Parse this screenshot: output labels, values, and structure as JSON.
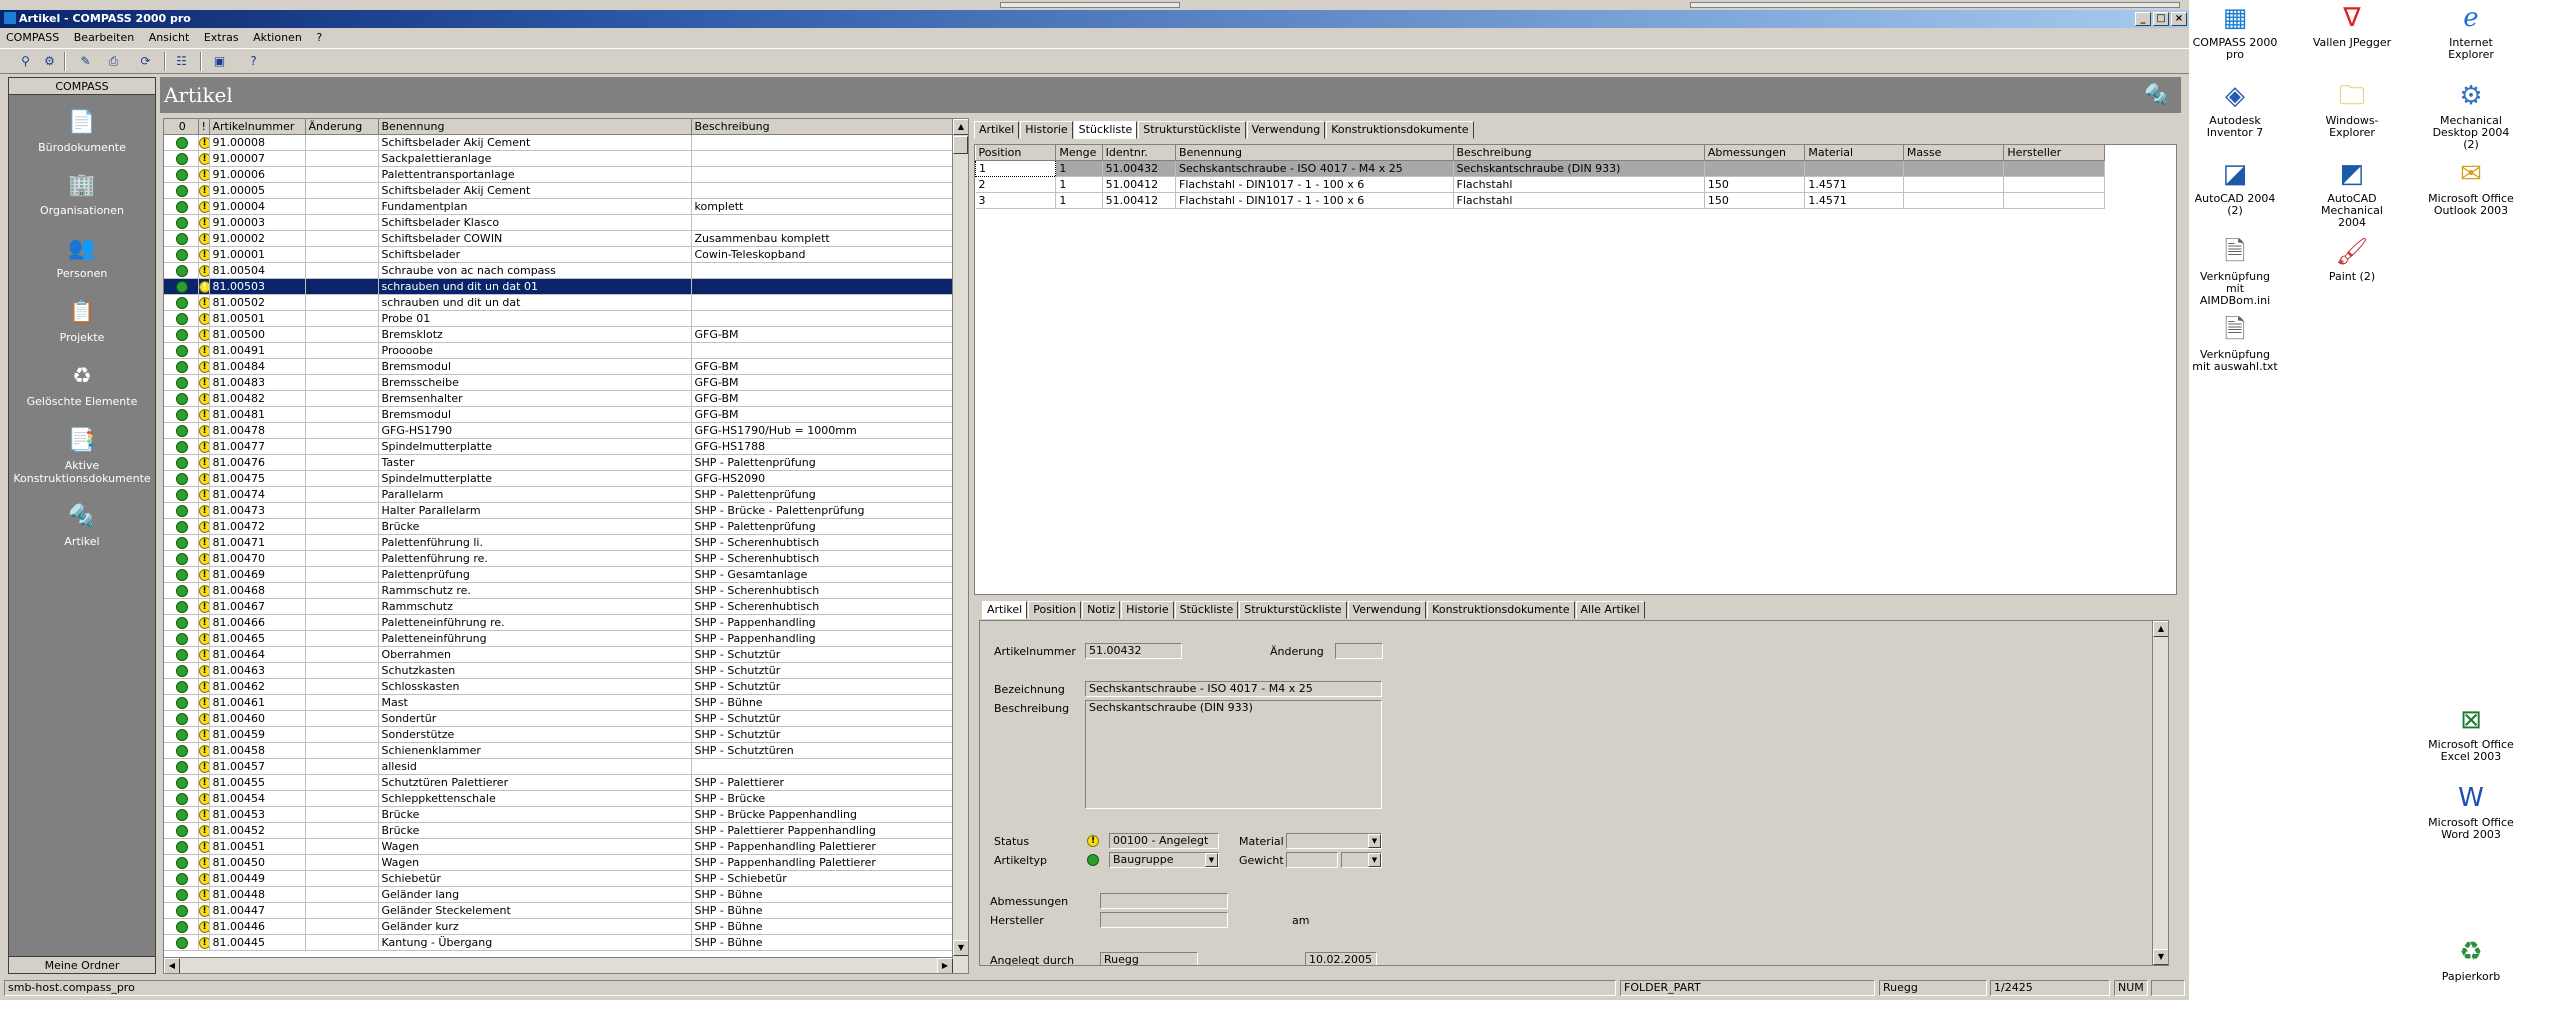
{
  "window": {
    "title": "Artikel - COMPASS 2000 pro",
    "menu": [
      "COMPASS",
      "Bearbeiten",
      "Ansicht",
      "Extras",
      "Aktionen",
      "?"
    ]
  },
  "sidebar": {
    "header": "COMPASS",
    "items": [
      {
        "label": "Bürodokumente",
        "icon": "document-icon"
      },
      {
        "label": "Organisationen",
        "icon": "building-icon"
      },
      {
        "label": "Personen",
        "icon": "people-icon"
      },
      {
        "label": "Projekte",
        "icon": "projects-icon"
      },
      {
        "label": "Gelöschte Elemente",
        "icon": "recycle-icon"
      },
      {
        "label": "Aktive Konstruktionsdokumente",
        "icon": "active-docs-icon"
      },
      {
        "label": "Artikel",
        "icon": "article-icon"
      }
    ],
    "footer": "Meine Ordner"
  },
  "page": {
    "title": "Artikel"
  },
  "article_table": {
    "headers": [
      "Artikelnummer",
      "Änderung",
      "Benennung",
      "Beschreibung"
    ],
    "selected_index": 9,
    "rows": [
      [
        "91.00008",
        "",
        "Schiftsbelader Akij Cement",
        ""
      ],
      [
        "91.00007",
        "",
        "Sackpalettieranlage",
        ""
      ],
      [
        "91.00006",
        "",
        "Palettentransportanlage",
        ""
      ],
      [
        "91.00005",
        "",
        "Schiftsbelader Akij Cement",
        ""
      ],
      [
        "91.00004",
        "",
        "Fundamentplan",
        "komplett"
      ],
      [
        "91.00003",
        "",
        "Schiftsbelader Klasco",
        ""
      ],
      [
        "91.00002",
        "",
        "Schiftsbelader COWIN",
        "Zusammenbau komplett"
      ],
      [
        "91.00001",
        "",
        "Schiftsbelader",
        "Cowin-Teleskopband"
      ],
      [
        "81.00504",
        "",
        "Schraube von ac nach compass",
        ""
      ],
      [
        "81.00503",
        "",
        "schrauben und dit un dat 01",
        ""
      ],
      [
        "81.00502",
        "",
        "schrauben und dit un dat",
        ""
      ],
      [
        "81.00501",
        "",
        "Probe 01",
        ""
      ],
      [
        "81.00500",
        "",
        "Bremsklotz",
        "GFG-BM"
      ],
      [
        "81.00491",
        "",
        "Proooobe",
        ""
      ],
      [
        "81.00484",
        "",
        "Bremsmodul",
        "GFG-BM"
      ],
      [
        "81.00483",
        "",
        "Bremsscheibe",
        "GFG-BM"
      ],
      [
        "81.00482",
        "",
        "Bremsenhalter",
        "GFG-BM"
      ],
      [
        "81.00481",
        "",
        "Bremsmodul",
        "GFG-BM"
      ],
      [
        "81.00478",
        "",
        "GFG-HS1790",
        "GFG-HS1790/Hub = 1000mm"
      ],
      [
        "81.00477",
        "",
        "Spindelmutterplatte",
        "GFG-HS1788"
      ],
      [
        "81.00476",
        "",
        "Taster",
        "SHP - Palettenprüfung"
      ],
      [
        "81.00475",
        "",
        "Spindelmutterplatte",
        "GFG-HS2090"
      ],
      [
        "81.00474",
        "",
        "Parallelarm",
        "SHP - Palettenprüfung"
      ],
      [
        "81.00473",
        "",
        "Halter Parallelarm",
        "SHP - Brücke - Palettenprüfung"
      ],
      [
        "81.00472",
        "",
        "Brücke",
        "SHP - Palettenprüfung"
      ],
      [
        "81.00471",
        "",
        "Palettenführung li.",
        "SHP - Scherenhubtisch"
      ],
      [
        "81.00470",
        "",
        "Palettenführung re.",
        "SHP - Scherenhubtisch"
      ],
      [
        "81.00469",
        "",
        "Palettenprüfung",
        "SHP - Gesamtanlage"
      ],
      [
        "81.00468",
        "",
        "Rammschutz re.",
        "SHP - Scherenhubtisch"
      ],
      [
        "81.00467",
        "",
        "Rammschutz",
        "SHP - Scherenhubtisch"
      ],
      [
        "81.00466",
        "",
        "Paletteneinführung re.",
        "SHP - Pappenhandling"
      ],
      [
        "81.00465",
        "",
        "Paletteneinführung",
        "SHP - Pappenhandling"
      ],
      [
        "81.00464",
        "",
        "Oberrahmen",
        "SHP - Schutztür"
      ],
      [
        "81.00463",
        "",
        "Schutzkasten",
        "SHP - Schutztür"
      ],
      [
        "81.00462",
        "",
        "Schlosskasten",
        "SHP - Schutztür"
      ],
      [
        "81.00461",
        "",
        "Mast",
        "SHP - Bühne"
      ],
      [
        "81.00460",
        "",
        "Sondertür",
        "SHP - Schutztür"
      ],
      [
        "81.00459",
        "",
        "Sonderstütze",
        "SHP - Schutztür"
      ],
      [
        "81.00458",
        "",
        "Schienenklammer",
        "SHP - Schutztüren"
      ],
      [
        "81.00457",
        "",
        "allesid",
        ""
      ],
      [
        "81.00455",
        "",
        "Schutztüren Palettierer",
        "SHP - Palettierer"
      ],
      [
        "81.00454",
        "",
        "Schleppkettenschale",
        "SHP - Brücke"
      ],
      [
        "81.00453",
        "",
        "Brücke",
        "SHP - Brücke Pappenhandling"
      ],
      [
        "81.00452",
        "",
        "Brücke",
        "SHP - Palettierer Pappenhandling"
      ],
      [
        "81.00451",
        "",
        "Wagen",
        "SHP - Pappenhandling Palettierer"
      ],
      [
        "81.00450",
        "",
        "Wagen",
        "SHP - Pappenhandling Palettierer"
      ],
      [
        "81.00449",
        "",
        "Schiebetür",
        "SHP - Schiebetür"
      ],
      [
        "81.00448",
        "",
        "Geländer lang",
        "SHP - Bühne"
      ],
      [
        "81.00447",
        "",
        "Geländer Steckelement",
        "SHP - Bühne"
      ],
      [
        "81.00446",
        "",
        "Geländer kurz",
        "SHP - Bühne"
      ],
      [
        "81.00445",
        "",
        "Kantung - Übergang",
        "SHP - Bühne"
      ]
    ]
  },
  "top_tabs": [
    "Artikel",
    "Historie",
    "Stückliste",
    "Strukturstückliste",
    "Verwendung",
    "Konstruktionsdokumente"
  ],
  "top_tabs_active": 2,
  "bom": {
    "headers": [
      "Position",
      "Menge",
      "Identnr.",
      "Benennung",
      "Beschreibung",
      "Abmessungen",
      "Material",
      "Masse",
      "Hersteller"
    ],
    "rows": [
      [
        "1",
        "1",
        "51.00432",
        "Sechskantschraube - ISO 4017 - M4 x 25",
        "Sechskantschraube (DIN 933)",
        "",
        "",
        "",
        ""
      ],
      [
        "2",
        "1",
        "51.00412",
        "Flachstahl - DIN1017 - 1 -  100 x    6",
        "Flachstahl",
        "150",
        "1.4571",
        "",
        ""
      ],
      [
        "3",
        "1",
        "51.00412",
        "Flachstahl - DIN1017 - 1 -  100 x    6",
        "Flachstahl",
        "150",
        "1.4571",
        "",
        ""
      ]
    ]
  },
  "bottom_tabs": [
    "Artikel",
    "Position",
    "Notiz",
    "Historie",
    "Stückliste",
    "Strukturstückliste",
    "Verwendung",
    "Konstruktionsdokumente",
    "Alle Artikel"
  ],
  "detail": {
    "artikelnummer_label": "Artikelnummer",
    "artikelnummer": "51.00432",
    "aenderung_label": "Änderung",
    "aenderung": "",
    "bezeichnung_label": "Bezeichnung",
    "bezeichnung": "Sechskantschraube - ISO 4017 - M4 x 25",
    "beschreibung_label": "Beschreibung",
    "beschreibung": "Sechskantschraube (DIN 933)",
    "status_label": "Status",
    "status": "00100 - Angelegt",
    "material_label": "Material",
    "material": "",
    "artikeltyp_label": "Artikeltyp",
    "artikeltyp": "Baugruppe",
    "gewicht_label": "Gewicht",
    "abmessungen_label": "Abmessungen",
    "hersteller_label": "Hersteller",
    "am_label": "am",
    "angelegt_label": "Angelegt durch",
    "angelegt": "Ruegg",
    "angelegt_date": "10.02.2005"
  },
  "statusbar": {
    "left": "smb-host.compass_pro",
    "folder": "FOLDER_PART",
    "user": "Ruegg",
    "count": "1/2425",
    "num": "NUM"
  },
  "desktop": {
    "icons": [
      {
        "label": "COMPASS 2000 pro",
        "glyph": "compass-logo-icon"
      },
      {
        "label": "Vallen JPegger",
        "glyph": "v-logo-icon"
      },
      {
        "label": "Internet Explorer",
        "glyph": "ie-icon"
      },
      {
        "label": "Autodesk Inventor 7",
        "glyph": "inventor-icon"
      },
      {
        "label": "Windows-Explorer",
        "glyph": "explorer-icon"
      },
      {
        "label": "Mechanical Desktop 2004 (2)",
        "glyph": "mdt-icon"
      },
      {
        "label": "AutoCAD 2004 (2)",
        "glyph": "autocad-icon"
      },
      {
        "label": "AutoCAD Mechanical 2004",
        "glyph": "autocad-mech-icon"
      },
      {
        "label": "Microsoft Office Outlook 2003",
        "glyph": "outlook-icon"
      },
      {
        "label": "Verknüpfung mit AIMDBom.ini",
        "glyph": "ini-file-icon"
      },
      {
        "label": "Paint (2)",
        "glyph": "paint-icon"
      },
      {
        "label": "Verknüpfung mit auswahl.txt",
        "glyph": "txt-file-icon"
      },
      {
        "label": "Microsoft Office Excel 2003",
        "glyph": "excel-icon"
      },
      {
        "label": "Microsoft Office Word 2003",
        "glyph": "word-icon"
      },
      {
        "label": "Papierkorb",
        "glyph": "recycle-bin-icon"
      }
    ]
  }
}
